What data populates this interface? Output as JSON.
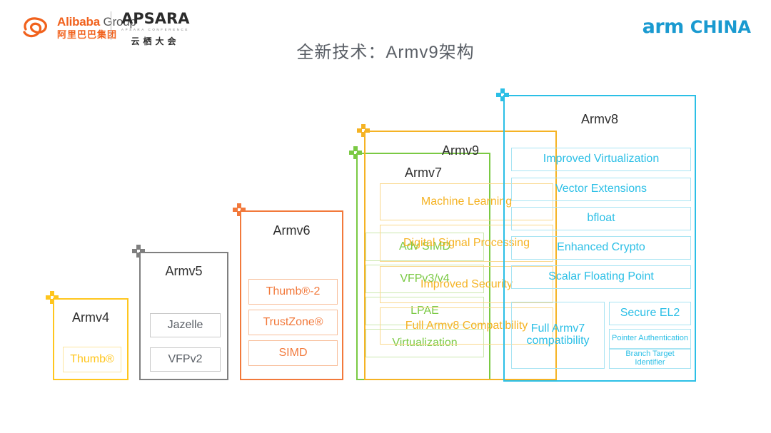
{
  "header": {
    "alibaba": {
      "en_brand": "Alibaba",
      "en_group": "Group",
      "cn": "阿里巴巴集团",
      "icon": "alibaba-swirl-logo"
    },
    "apsara": {
      "word": "APSARA",
      "subtitle": "APSARA CONFERENCE",
      "cn": "云栖大会"
    },
    "arm_china": {
      "arm": "arm",
      "china": "CHINA"
    },
    "title": "全新技术：Armv9架构"
  },
  "colors": {
    "armv4": "#FFC61E",
    "armv5": "#7F7F7F",
    "armv6": "#F2793B",
    "armv7": "#7AC943",
    "armv8": "#2BBFE6",
    "armv9": "#F5B324",
    "title_text": "#5a5f66",
    "arm_china_blue": "#1a9ad0",
    "alibaba_orange": "#f1611c"
  },
  "architectures": [
    {
      "id": "armv4",
      "title": "Armv4",
      "plus_icon": "plus-icon-armv4",
      "features": [
        "Thumb®"
      ]
    },
    {
      "id": "armv5",
      "title": "Armv5",
      "plus_icon": "plus-icon-armv5",
      "features": [
        "Jazelle",
        "VFPv2"
      ]
    },
    {
      "id": "armv6",
      "title": "Armv6",
      "plus_icon": "plus-icon-armv6",
      "features": [
        "Thumb®-2",
        "TrustZone®",
        "SIMD"
      ]
    },
    {
      "id": "armv7",
      "title": "Armv7",
      "plus_icon": "plus-icon-armv7",
      "features": [
        "Adv SIMD",
        "VFPv3/v4",
        "LPAE",
        "Virtualization"
      ]
    },
    {
      "id": "armv8",
      "title": "Armv8",
      "plus_icon": "plus-icon-armv8",
      "features": [
        "Improved Virtualization",
        "Vector Extensions",
        "bfloat",
        "Enhanced Crypto",
        "Scalar Floating Point",
        "Full Armv7 compatibility",
        "Secure EL2",
        "Pointer Authentication",
        "Branch Target Identifier"
      ]
    },
    {
      "id": "armv9",
      "title": "Armv9",
      "plus_icon": "plus-icon-armv9",
      "features": [
        "Machine Learning",
        "Digital Signal Processing",
        "Improved Security",
        "Full Armv8 Compatibility"
      ]
    }
  ]
}
